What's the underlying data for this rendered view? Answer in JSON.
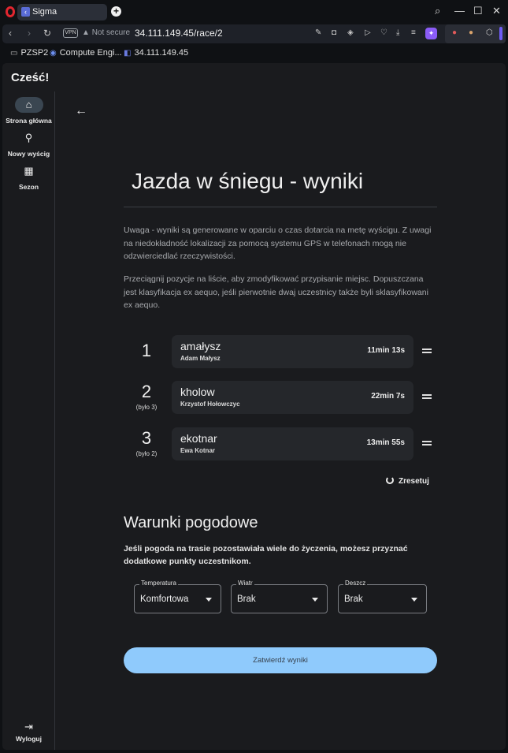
{
  "browser": {
    "tab_title": "Sigma",
    "favicon": "‹",
    "not_secure": "Not secure",
    "url": "34.111.149.45/race/2",
    "vpn_badge": "VPN",
    "bookmarks": [
      {
        "icon": "folder-icon",
        "label": "PZSP2"
      },
      {
        "icon": "compute-engine-icon",
        "label": "Compute Engi..."
      },
      {
        "icon": "sigma-icon",
        "label": "34.111.149.45"
      }
    ]
  },
  "app": {
    "greeting": "Cześć!",
    "nav": [
      {
        "label": "Strona główna",
        "icon": "home-icon"
      },
      {
        "label": "Nowy wyścig",
        "icon": "bike-icon"
      },
      {
        "label": "Sezon",
        "icon": "calendar-icon"
      }
    ],
    "logout_label": "Wyloguj"
  },
  "page": {
    "title": "Jazda w śniegu - wyniki",
    "notice_1": "Uwaga - wyniki są generowane w oparciu o czas dotarcia na metę wyścigu. Z uwagi na niedokładność lokalizacji za pomocą systemu GPS w telefonach mogą nie odzwierciedlać rzeczywistości.",
    "notice_2": "Przeciągnij pozycje na liście, aby zmodyfikować przypisanie miejsc. Dopuszczana jest klasyfikacja ex aequo, jeśli pierwotnie dwaj uczestnicy także byli sklasyfikowani ex aequo.",
    "results": [
      {
        "place": "1",
        "previous": "",
        "nick": "amałysz",
        "name": "Adam Małysz",
        "time": "11min 13s"
      },
      {
        "place": "2",
        "previous": "(było 3)",
        "nick": "kholow",
        "name": "Krzystof Hołowczyc",
        "time": "22min 7s"
      },
      {
        "place": "3",
        "previous": "(było 2)",
        "nick": "ekotnar",
        "name": "Ewa Kotnar",
        "time": "13min 55s"
      }
    ],
    "reset_label": "Zresetuj",
    "weather_title": "Warunki pogodowe",
    "weather_desc": "Jeśli pogoda na trasie pozostawiała wiele do życzenia, możesz przyznać dodatkowe punkty uczestnikom.",
    "fields": [
      {
        "label": "Temperatura",
        "value": "Komfortowa"
      },
      {
        "label": "Wiatr",
        "value": "Brak"
      },
      {
        "label": "Deszcz",
        "value": "Brak"
      }
    ],
    "submit_label": "Zatwierdź wyniki"
  }
}
